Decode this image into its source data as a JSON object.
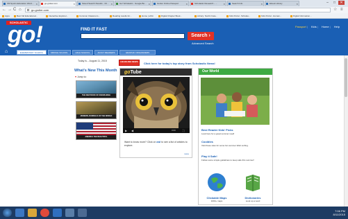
{
  "browser": {
    "tabs": [
      {
        "label": "FM Sports Education Word..."
      },
      {
        "label": "go.grolier.com"
      },
      {
        "label": "Saved Search Results - Ch..."
      },
      {
        "label": "Go! Scholastic - Google Bo..."
      },
      {
        "label": "Grolier Online Passport"
      },
      {
        "label": "Scholastic Research - ..."
      },
      {
        "label": "Search Info"
      },
      {
        "label": "Ebook Library"
      }
    ],
    "window_controls": [
      "–",
      "□",
      "✕"
    ],
    "url": "go.grolier.com",
    "bookmarks": [
      "Apps",
      "Best Kid Educational...",
      "Interactive Explorer...",
      "Common Classroom...",
      "Reading results for...",
      "Home | eFlm",
      "Digital Chapter Book...",
      "Library: Nonfic Cate...",
      "Kids Portal - Scholas...",
      "Kids Portal - Human...",
      "Digital Information..."
    ]
  },
  "header": {
    "scholastic_tag": "SCHOLASTIC",
    "logo_text": "go!",
    "find_label": "FIND IT FAST",
    "search_placeholder": "",
    "search_button": "Search",
    "advanced_search": "Advanced Search",
    "top_links": [
      "Passport",
      "Kids",
      "Home",
      "Help"
    ]
  },
  "nav": {
    "tabs": [
      "ELEMENTARY SCHOOL",
      "MIDDLE SCHOOL",
      "HIGH SCHOOL",
      "ADULT READERS",
      "GRAPHIC ORGANIZERS"
    ]
  },
  "left": {
    "date": "Today is... August 11, 2015",
    "title": "What's New This Month",
    "jump_to": "Jump to:",
    "thumbnails": [
      {
        "caption": "THE NEW BOOK OF KNOWLEDGE",
        "color": "#5a8fb0"
      },
      {
        "caption": "MODERN JOURNALS OF THE WORLD",
        "color": "#7a6b3a"
      },
      {
        "caption": "AMERICA THE BEAUTIFUL",
        "color": "#b02030"
      }
    ]
  },
  "center": {
    "headline_badge": "HEADLINE NEWS",
    "headline_link": "Click here for today's top story from Scholastic News!",
    "gotube_label": "Tube",
    "gotube_prefix": "go",
    "player_time": "0:00",
    "description": "Want to know more? Click on",
    "description_link": "owl",
    "description_tail": "to see a list of articles to explore.",
    "more_label": "more"
  },
  "ourworld": {
    "title": "Our World",
    "items": [
      {
        "title": "Best Reader Kids' Picks",
        "desc": "Look here for a great summer read!"
      },
      {
        "title": "Cooldies",
        "desc": "Visit these sites for some fun summer Web surfing."
      },
      {
        "title": "Play it Safe!",
        "desc": "Follow some simple guidelines to keep safe this summer!"
      }
    ],
    "tools": [
      {
        "name": "Clickable Maps",
        "sub": "1000+ maps"
      },
      {
        "name": "Dictionaries",
        "sub": "Look up a word"
      }
    ]
  },
  "taskbar": {
    "time": "7:06 PM",
    "date": "8/11/2015"
  },
  "colors": {
    "brand_blue": "#1a5fb4",
    "search_red": "#e23226",
    "our_world_green": "#3eaa43"
  }
}
